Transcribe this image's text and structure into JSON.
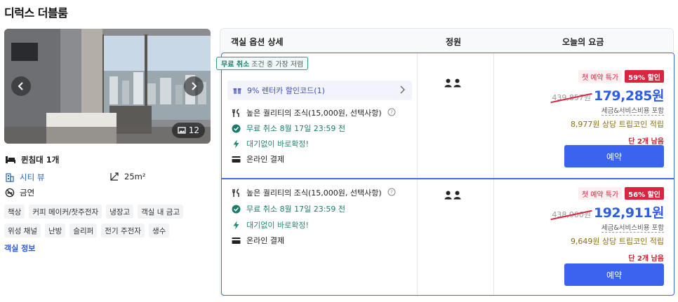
{
  "room_title": "디럭스 더블룸",
  "photo": {
    "count": "12"
  },
  "features": {
    "bed": "퀸침대 1개",
    "view": "시티 뷰",
    "area": "25m²",
    "smoking": "금연"
  },
  "amenities": [
    "책상",
    "커피 메이커/찻주전자",
    "냉장고",
    "객실 내 금고",
    "위성 채널",
    "난방",
    "슬리퍼",
    "전기 주전자",
    "생수"
  ],
  "room_info_link": "객실 정보",
  "table_header": {
    "option": "객실 옵션 상세",
    "capacity": "정원",
    "price": "오늘의 요금"
  },
  "options": [
    {
      "badge_bold": "무료 취소",
      "badge_rest": "조건 중 가장 저렴",
      "coupon": "9% 렌터카 할인코드(1)",
      "breakfast": "높은 퀄리티의 조식(15,000원, 선택사항)",
      "cancel": "무료 취소 8월 17일 23:59 전",
      "instant": "대기없이 바로확정!",
      "payment": "온라인 결제",
      "first_badge": "첫 예약 특가",
      "discount": "59% 할인",
      "original_price": "439,857원",
      "price": "179,285원",
      "tax": "세금&서비스비용 포함",
      "coin": "8,977원 상당 트립코인 적립",
      "remaining": "단 2개 남음",
      "reserve": "예약"
    },
    {
      "breakfast": "높은 퀄리티의 조식(15,000원, 선택사항)",
      "cancel": "무료 취소 8월 17일 23:59 전",
      "instant": "대기없이 바로확정!",
      "payment": "온라인 결제",
      "first_badge": "첫 예약 특가",
      "discount": "56% 할인",
      "original_price": "438,000원",
      "price": "192,911원",
      "tax": "세금&서비스비용 포함",
      "coin": "9,649원 상당 트립코인 적립",
      "remaining": "단 2개 남음",
      "reserve": "예약"
    }
  ],
  "colors": {
    "accent": "#3a63ee",
    "discount": "#d9253f",
    "free_cancel": "#1d7a68"
  }
}
